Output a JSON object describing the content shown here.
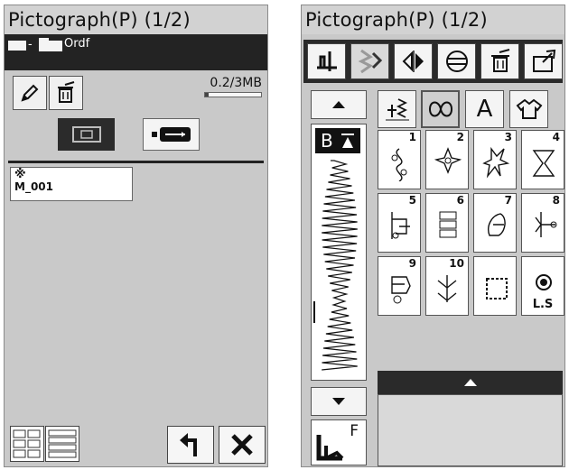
{
  "left": {
    "title": "Pictograph(P) (1/2)",
    "path": {
      "separator": "-",
      "folder_name": "Ordf"
    },
    "memory": {
      "text": "0.2/3MB",
      "used_fraction": 0.07
    },
    "files": [
      {
        "name": "M_001",
        "icon": "pattern-file-icon"
      }
    ],
    "icons": {
      "edit": "pencil-icon",
      "delete": "trash-icon",
      "machine": "machine-memory-icon",
      "usb": "usb-icon",
      "back": "back-arrow-icon",
      "close": "close-icon"
    }
  },
  "right": {
    "title": "Pictograph(P) (1/2)",
    "toolbar": [
      "presser-foot-icon",
      "combine-patterns-icon",
      "mirror-icon",
      "elongation-icon",
      "delete-icon",
      "exit-icon"
    ],
    "categories": [
      {
        "name": "utility-stitches-icon",
        "label": ""
      },
      {
        "name": "pictograph-icon",
        "label": ""
      },
      {
        "name": "alphabet-icon",
        "label": "A"
      },
      {
        "name": "garment-icon",
        "label": ""
      }
    ],
    "preview": {
      "letter": "B"
    },
    "foot": {
      "letter": "F"
    },
    "patterns": [
      {
        "num": "1"
      },
      {
        "num": "2"
      },
      {
        "num": "3"
      },
      {
        "num": "4"
      },
      {
        "num": "5"
      },
      {
        "num": "6"
      },
      {
        "num": "7"
      },
      {
        "num": "8"
      },
      {
        "num": "9"
      },
      {
        "num": "10"
      },
      {
        "num": ""
      },
      {
        "num": "",
        "label": "L.S"
      }
    ],
    "colors": {
      "dark_bar": "#2a2a2a",
      "panel_bg": "#c9c9c9",
      "button_bg": "#f4f4f4"
    }
  }
}
